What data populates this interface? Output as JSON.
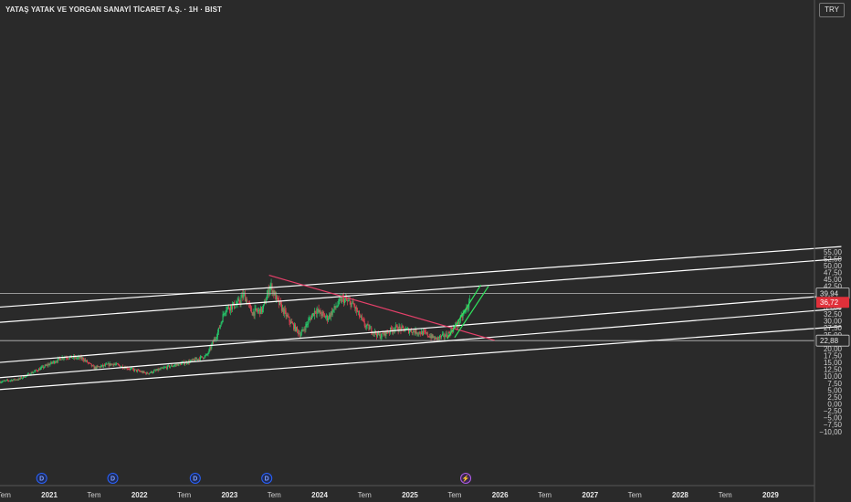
{
  "header": {
    "title": "YATAŞ YATAK VE YORGAN SANAYİ TİCARET A.Ş. · 1H · BIST",
    "currency": "TRY"
  },
  "colors": {
    "background": "#2a2a2a",
    "up_candle": "#26c96b",
    "down_candle": "#e04353",
    "channel_lines": "#ffffff",
    "downtrend_line": "#e5406a",
    "uptrend_lines": "#2ee65e",
    "last_price_bg": "#e0303a",
    "dividend_badge": "#2962ff",
    "split_badge": "#b05de8"
  },
  "chart_data": {
    "type": "candlestick",
    "symbol": "YATAŞ YATAK VE YORGAN SANAYİ TİCARET A.Ş.",
    "interval": "1H",
    "exchange": "BIST",
    "y_axis": {
      "ticks": [
        "55,00",
        "52,50",
        "50,00",
        "47,50",
        "45,00",
        "42,50",
        "40,00",
        "37,50",
        "35,00",
        "32,50",
        "30,00",
        "27,50",
        "25,00",
        "22,50",
        "20,00",
        "17,50",
        "15,00",
        "12,50",
        "10,00",
        "7,50",
        "5,00",
        "2,50",
        "0,00",
        "−2,50",
        "−5,00",
        "−7,50",
        "−10,00"
      ],
      "range": [
        -11,
        57
      ]
    },
    "x_axis": {
      "ticks": [
        {
          "label": "Tem",
          "year": false
        },
        {
          "label": "2021",
          "year": true
        },
        {
          "label": "Tem",
          "year": false
        },
        {
          "label": "2022",
          "year": true
        },
        {
          "label": "Tem",
          "year": false
        },
        {
          "label": "2023",
          "year": true
        },
        {
          "label": "Tem",
          "year": false
        },
        {
          "label": "2024",
          "year": true
        },
        {
          "label": "Tem",
          "year": false
        },
        {
          "label": "2025",
          "year": true
        },
        {
          "label": "Tem",
          "year": false
        },
        {
          "label": "2026",
          "year": true
        },
        {
          "label": "Tem",
          "year": false
        },
        {
          "label": "2027",
          "year": true
        },
        {
          "label": "Tem",
          "year": false
        },
        {
          "label": "2028",
          "year": true
        },
        {
          "label": "Tem",
          "year": false
        },
        {
          "label": "2029",
          "year": true
        }
      ],
      "range": [
        "2020-06-15",
        "2029-12-31"
      ]
    },
    "price_path": [
      {
        "date": "2020-06-15",
        "price": 8.0
      },
      {
        "date": "2020-09-01",
        "price": 9.0
      },
      {
        "date": "2020-12-01",
        "price": 13.0
      },
      {
        "date": "2021-03-01",
        "price": 17.0
      },
      {
        "date": "2021-05-15",
        "price": 16.5
      },
      {
        "date": "2021-07-01",
        "price": 13.0
      },
      {
        "date": "2021-09-15",
        "price": 14.5
      },
      {
        "date": "2021-12-01",
        "price": 12.5
      },
      {
        "date": "2022-02-01",
        "price": 11.0
      },
      {
        "date": "2022-05-01",
        "price": 13.5
      },
      {
        "date": "2022-08-01",
        "price": 15.5
      },
      {
        "date": "2022-10-01",
        "price": 17.5
      },
      {
        "date": "2022-11-15",
        "price": 26.0
      },
      {
        "date": "2022-12-15",
        "price": 34.5
      },
      {
        "date": "2023-02-01",
        "price": 36.0
      },
      {
        "date": "2023-03-01",
        "price": 39.5
      },
      {
        "date": "2023-04-01",
        "price": 33.0
      },
      {
        "date": "2023-05-15",
        "price": 34.0
      },
      {
        "date": "2023-06-15",
        "price": 43.0
      },
      {
        "date": "2023-07-15",
        "price": 37.0
      },
      {
        "date": "2023-09-01",
        "price": 30.0
      },
      {
        "date": "2023-10-15",
        "price": 25.0
      },
      {
        "date": "2023-12-15",
        "price": 34.0
      },
      {
        "date": "2024-02-01",
        "price": 31.0
      },
      {
        "date": "2024-04-01",
        "price": 38.0
      },
      {
        "date": "2024-05-15",
        "price": 36.0
      },
      {
        "date": "2024-07-01",
        "price": 28.5
      },
      {
        "date": "2024-09-01",
        "price": 24.5
      },
      {
        "date": "2024-11-01",
        "price": 27.5
      },
      {
        "date": "2025-01-01",
        "price": 26.5
      },
      {
        "date": "2025-03-01",
        "price": 25.5
      },
      {
        "date": "2025-04-15",
        "price": 23.5
      },
      {
        "date": "2025-06-01",
        "price": 25.0
      },
      {
        "date": "2025-07-15",
        "price": 29.0
      },
      {
        "date": "2025-09-01",
        "price": 36.72
      }
    ],
    "price_lines": [
      {
        "label": "39,94",
        "value": 39.94,
        "highlight": false
      },
      {
        "label": "22,88",
        "value": 22.88,
        "highlight": false
      }
    ],
    "last_price": {
      "label": "36,72",
      "value": 36.72
    },
    "extra_label": {
      "label": "37,50",
      "value": 37.5
    },
    "channel_lines": [
      {
        "start": {
          "date": "2020-06-15",
          "value": 35.0
        },
        "end": {
          "date": "2029-10-15",
          "value": 56.9
        }
      },
      {
        "start": {
          "date": "2020-06-15",
          "value": 29.5
        },
        "end": {
          "date": "2029-10-15",
          "value": 52.5
        }
      },
      {
        "start": {
          "date": "2020-06-15",
          "value": 15.0
        },
        "end": {
          "date": "2029-10-15",
          "value": 39.5
        }
      },
      {
        "start": {
          "date": "2020-06-15",
          "value": 9.5
        },
        "end": {
          "date": "2029-10-15",
          "value": 34.5
        }
      },
      {
        "start": {
          "date": "2020-06-15",
          "value": 5.2
        },
        "end": {
          "date": "2029-10-15",
          "value": 28.0
        }
      }
    ],
    "trend_lines": [
      {
        "color": "downtrend",
        "start": {
          "date": "2023-06-10",
          "value": 46.5
        },
        "end": {
          "date": "2025-12-10",
          "value": 23.0
        }
      },
      {
        "color": "uptrend",
        "start": {
          "date": "2025-06-01",
          "value": 23.5
        },
        "end": {
          "date": "2025-10-15",
          "value": 43.0
        }
      },
      {
        "color": "uptrend",
        "start": {
          "date": "2025-07-01",
          "value": 24.0
        },
        "end": {
          "date": "2025-11-15",
          "value": 42.5
        }
      }
    ],
    "event_badges": [
      {
        "type": "dividend",
        "symbol": "D",
        "date": "2020-12-01"
      },
      {
        "type": "dividend",
        "symbol": "D",
        "date": "2021-09-15"
      },
      {
        "type": "dividend",
        "symbol": "D",
        "date": "2022-08-15"
      },
      {
        "type": "dividend",
        "symbol": "D",
        "date": "2023-06-01"
      },
      {
        "type": "split",
        "symbol": "⚡",
        "date": "2025-08-15"
      }
    ]
  }
}
